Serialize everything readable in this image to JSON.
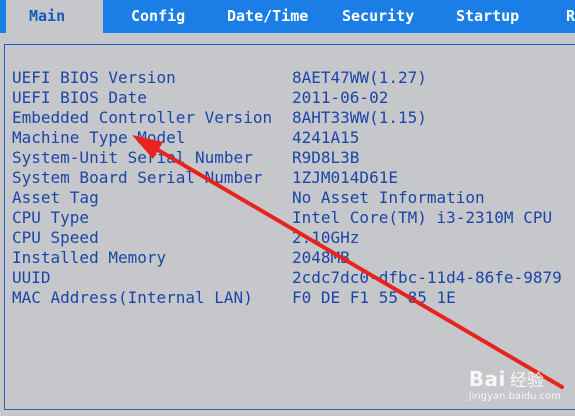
{
  "tabs": [
    {
      "label": "Main",
      "active": true
    },
    {
      "label": "Config"
    },
    {
      "label": "Date/Time"
    },
    {
      "label": "Security"
    },
    {
      "label": "Startup"
    },
    {
      "label": "R"
    }
  ],
  "system_info": [
    {
      "label": "UEFI BIOS Version",
      "value": "8AET47WW(1.27)"
    },
    {
      "label": "UEFI BIOS Date",
      "value": "2011-06-02"
    },
    {
      "label": "Embedded Controller Version",
      "value": "8AHT33WW(1.15)"
    },
    {
      "label": "Machine Type Model",
      "value": "4241A15"
    },
    {
      "label": "System-Unit Serial Number",
      "value": "R9D8L3B"
    },
    {
      "label": "System Board Serial Number",
      "value": "1ZJM014D61E"
    },
    {
      "label": "Asset Tag",
      "value": "No Asset Information"
    },
    {
      "label": "CPU Type",
      "value": "Intel Core(TM) i3-2310M CPU"
    },
    {
      "label": "CPU Speed",
      "value": "2.10GHz"
    },
    {
      "label": "Installed Memory",
      "value": "2048MB"
    },
    {
      "label": "UUID",
      "value": "2cdc7dc0-dfbc-11d4-86fe-9879"
    },
    {
      "label": "MAC Address(Internal LAN)",
      "value": "F0 DE F1 55 85 1E"
    }
  ],
  "colors": {
    "tabbar": "#1a7ee6",
    "background": "#c6c7ca",
    "text": "#1b46a8",
    "arrow": "#e8231e"
  },
  "watermark": {
    "brand": "Bai",
    "brand_cn": "经验",
    "site": "jingyan.baidu.com"
  }
}
